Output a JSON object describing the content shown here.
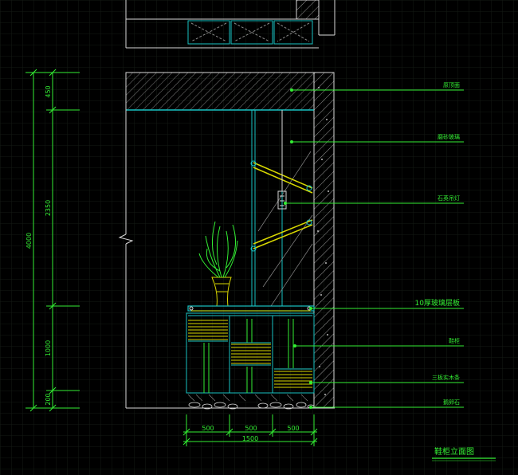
{
  "drawing": {
    "title": "鞋柜立面图",
    "colors": {
      "background": "#000000",
      "grid": "#141a14",
      "line_white": "#d8d8d8",
      "line_cyan": "#19c2c2",
      "line_green": "#33ee33",
      "line_yellow": "#d8d800",
      "line_gray": "#8a8a8a"
    },
    "annotations": [
      "原顶面",
      "磨砂玻璃",
      "石英吊灯",
      "10厚玻璃层板",
      "鞋柜",
      "三板实木条",
      "鹅卵石"
    ],
    "vertical_dims": {
      "total": "4000",
      "segments": [
        "450",
        "2350",
        "1000",
        "200"
      ]
    },
    "horizontal_dims": {
      "segments": [
        "500",
        "500",
        "500"
      ],
      "total": "1500"
    }
  }
}
